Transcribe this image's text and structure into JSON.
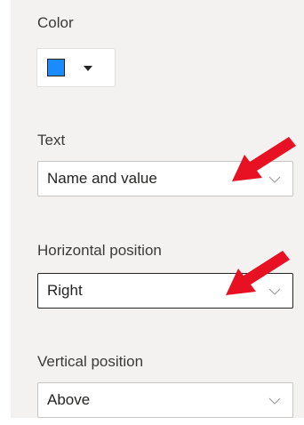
{
  "color_section": {
    "label": "Color",
    "selected_color": "#1a8cff",
    "swatch_border_color": "#252423",
    "dropdown_icon": "caret-down-icon"
  },
  "text_field": {
    "label": "Text",
    "value": "Name and value",
    "icon": "chevron-down-icon"
  },
  "horizontal_position": {
    "label": "Horizontal position",
    "value": "Right",
    "icon": "chevron-down-icon"
  },
  "vertical_position": {
    "label": "Vertical position",
    "value": "Above",
    "icon": "chevron-down-icon"
  },
  "annotations": {
    "arrow_color": "#e81123",
    "arrow_icon": "red-arrow-icon"
  }
}
